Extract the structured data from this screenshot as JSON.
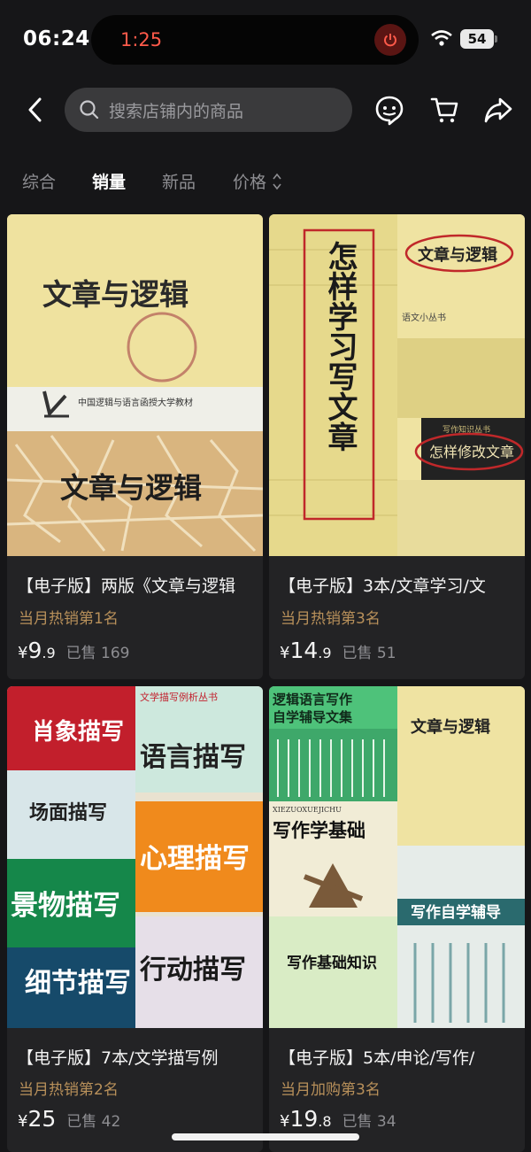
{
  "status_bar": {
    "time": "06:24",
    "island_timer": "1:25",
    "battery": "54"
  },
  "header": {
    "search_placeholder": "搜索店铺内的商品"
  },
  "tabs": [
    {
      "label": "综合",
      "active": false
    },
    {
      "label": "销量",
      "active": true
    },
    {
      "label": "新品",
      "active": false
    },
    {
      "label": "价格",
      "active": false
    }
  ],
  "products": [
    {
      "title": "【电子版】两版《文章与逻辑",
      "rank": "当月热销第1名",
      "currency": "¥",
      "price_int": "9",
      "price_dec": ".9",
      "sold": "已售 169",
      "cover_texts": {
        "main": "文章与逻辑",
        "series": "中国逻辑与语言函授大学教材",
        "bottom": "文章与逻辑"
      }
    },
    {
      "title": "【电子版】3本/文章学习/文",
      "rank": "当月热销第3名",
      "currency": "¥",
      "price_int": "14",
      "price_dec": ".9",
      "sold": "已售 51",
      "cover_texts": {
        "vertical": "怎样学习写文章",
        "right_top": "文章与逻辑",
        "series": "语文小丛书",
        "small": "写作知识丛书",
        "bottom_box": "怎样修改文章"
      }
    },
    {
      "title": "【电子版】7本/文学描写例",
      "rank": "当月热销第2名",
      "currency": "¥",
      "price_int": "25",
      "price_dec": "",
      "sold": "已售 42",
      "cover_texts": {
        "series": "文学描写例析丛书",
        "t1": "肖象描写",
        "t2": "语言描写",
        "t3": "场面描写",
        "t4": "心理描写",
        "t5": "景物描写",
        "t6": "行动描写",
        "t7": "细节描写"
      }
    },
    {
      "title": "【电子版】5本/申论/写作/",
      "rank": "当月加购第3名",
      "currency": "¥",
      "price_int": "19",
      "price_dec": ".8",
      "sold": "已售 34",
      "cover_texts": {
        "a": "逻辑语言写作",
        "a2": "自学辅导文集",
        "b": "文章与逻辑",
        "c_pinyin": "XIEZUOXUEJICHU",
        "c": "写作学基础",
        "d": "写作基础知识",
        "e": "写作自学辅导"
      }
    }
  ],
  "colors": {
    "background": "#161618",
    "card": "#232325",
    "rank_gold": "#b8905a",
    "timer_red": "#ff5a4a"
  }
}
